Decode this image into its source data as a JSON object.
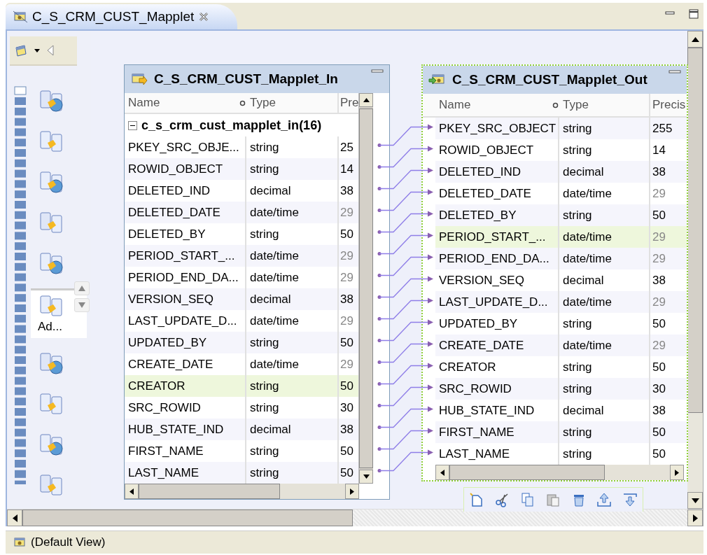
{
  "editor_tab": {
    "title": "C_S_CRM_CUST_Mapplet",
    "selected": true
  },
  "palette": {
    "items": [
      {
        "selected": false
      },
      {
        "selected": false
      },
      {
        "selected": false
      },
      {
        "selected": false
      },
      {
        "selected": false
      },
      {
        "label": "Ad...",
        "selected": true
      },
      {
        "selected": false
      },
      {
        "selected": false
      },
      {
        "selected": false
      },
      {
        "selected": false
      }
    ]
  },
  "input_table": {
    "title": "C_S_CRM_CUST_Mapplet_In",
    "columns": [
      "Name",
      "Type",
      "Pre"
    ],
    "group": {
      "label": "c_s_crm_cust_mapplet_in",
      "count": "(16)",
      "expanded": true
    },
    "rows": [
      {
        "name": "PKEY_SRC_OBJE...",
        "type": "string",
        "precision": "25",
        "precision_disabled": false,
        "selected": false
      },
      {
        "name": "ROWID_OBJECT",
        "type": "string",
        "precision": "14",
        "precision_disabled": false,
        "selected": false
      },
      {
        "name": "DELETED_IND",
        "type": "decimal",
        "precision": "38",
        "precision_disabled": false,
        "selected": false
      },
      {
        "name": "DELETED_DATE",
        "type": "date/time",
        "precision": "29",
        "precision_disabled": true,
        "selected": false
      },
      {
        "name": "DELETED_BY",
        "type": "string",
        "precision": "50",
        "precision_disabled": false,
        "selected": false
      },
      {
        "name": "PERIOD_START_...",
        "type": "date/time",
        "precision": "29",
        "precision_disabled": true,
        "selected": false
      },
      {
        "name": "PERIOD_END_DA...",
        "type": "date/time",
        "precision": "29",
        "precision_disabled": true,
        "selected": false
      },
      {
        "name": "VERSION_SEQ",
        "type": "decimal",
        "precision": "38",
        "precision_disabled": false,
        "selected": false
      },
      {
        "name": "LAST_UPDATE_D...",
        "type": "date/time",
        "precision": "29",
        "precision_disabled": true,
        "selected": false
      },
      {
        "name": "UPDATED_BY",
        "type": "string",
        "precision": "50",
        "precision_disabled": false,
        "selected": false
      },
      {
        "name": "CREATE_DATE",
        "type": "date/time",
        "precision": "29",
        "precision_disabled": true,
        "selected": false
      },
      {
        "name": "CREATOR",
        "type": "string",
        "precision": "50",
        "precision_disabled": false,
        "selected": true
      },
      {
        "name": "SRC_ROWID",
        "type": "string",
        "precision": "30",
        "precision_disabled": false,
        "selected": false
      },
      {
        "name": "HUB_STATE_IND",
        "type": "decimal",
        "precision": "38",
        "precision_disabled": false,
        "selected": false
      },
      {
        "name": "FIRST_NAME",
        "type": "string",
        "precision": "50",
        "precision_disabled": false,
        "selected": false
      },
      {
        "name": "LAST_NAME",
        "type": "string",
        "precision": "50",
        "precision_disabled": false,
        "selected": false
      }
    ]
  },
  "output_table": {
    "title": "C_S_CRM_CUST_Mapplet_Out",
    "selected": true,
    "columns": [
      "Name",
      "Type",
      "Precis"
    ],
    "rows": [
      {
        "name": "PKEY_SRC_OBJECT",
        "type": "string",
        "precision": "255",
        "precision_disabled": false,
        "selected": false
      },
      {
        "name": "ROWID_OBJECT",
        "type": "string",
        "precision": "14",
        "precision_disabled": false,
        "selected": false
      },
      {
        "name": "DELETED_IND",
        "type": "decimal",
        "precision": "38",
        "precision_disabled": false,
        "selected": false
      },
      {
        "name": "DELETED_DATE",
        "type": "date/time",
        "precision": "29",
        "precision_disabled": true,
        "selected": false
      },
      {
        "name": "DELETED_BY",
        "type": "string",
        "precision": "50",
        "precision_disabled": false,
        "selected": false
      },
      {
        "name": "PERIOD_START_...",
        "type": "date/time",
        "precision": "29",
        "precision_disabled": true,
        "selected": true
      },
      {
        "name": "PERIOD_END_DA...",
        "type": "date/time",
        "precision": "29",
        "precision_disabled": true,
        "selected": false
      },
      {
        "name": "VERSION_SEQ",
        "type": "decimal",
        "precision": "38",
        "precision_disabled": false,
        "selected": false
      },
      {
        "name": "LAST_UPDATE_D...",
        "type": "date/time",
        "precision": "29",
        "precision_disabled": true,
        "selected": false
      },
      {
        "name": "UPDATED_BY",
        "type": "string",
        "precision": "50",
        "precision_disabled": false,
        "selected": false
      },
      {
        "name": "CREATE_DATE",
        "type": "date/time",
        "precision": "29",
        "precision_disabled": true,
        "selected": false
      },
      {
        "name": "CREATOR",
        "type": "string",
        "precision": "50",
        "precision_disabled": false,
        "selected": false
      },
      {
        "name": "SRC_ROWID",
        "type": "string",
        "precision": "30",
        "precision_disabled": false,
        "selected": false
      },
      {
        "name": "HUB_STATE_IND",
        "type": "decimal",
        "precision": "38",
        "precision_disabled": false,
        "selected": false
      },
      {
        "name": "FIRST_NAME",
        "type": "string",
        "precision": "50",
        "precision_disabled": false,
        "selected": false
      },
      {
        "name": "LAST_NAME",
        "type": "string",
        "precision": "50",
        "precision_disabled": false,
        "selected": false
      }
    ]
  },
  "status_bar": {
    "view": "(Default View)"
  }
}
